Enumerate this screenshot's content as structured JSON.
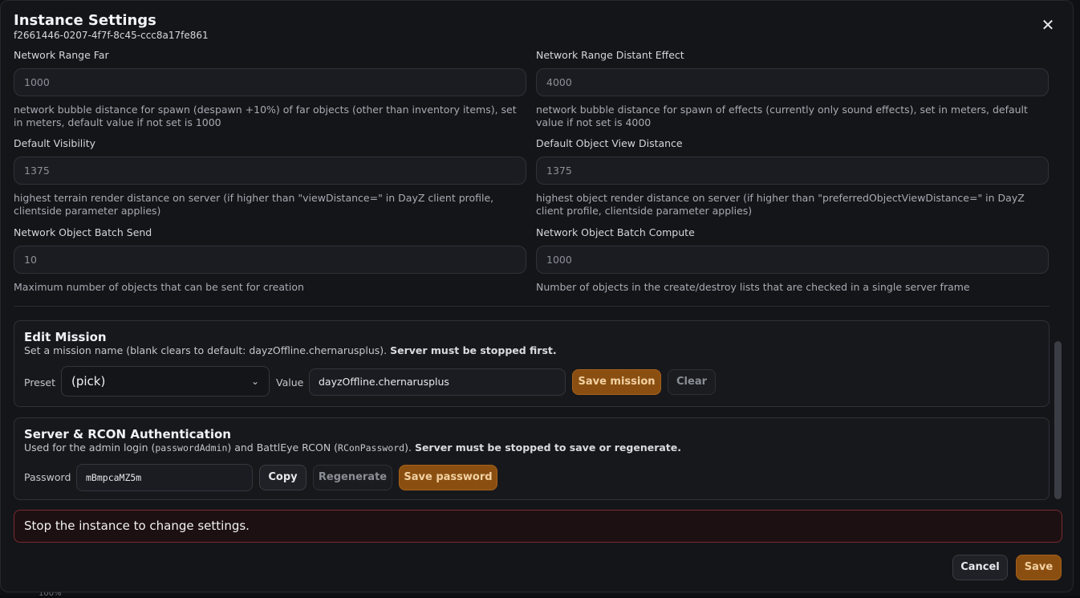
{
  "modal": {
    "title": "Instance Settings",
    "subtitle": "f2661446-0207-4f7f-8c45-ccc8a17fe861",
    "close_icon": "close-icon"
  },
  "fields": [
    {
      "label": "Network Range Far",
      "value": "1000",
      "help": "network bubble distance for spawn (despawn +10%) of far objects (other than inventory items), set in meters, default value if not set is 1000"
    },
    {
      "label": "Network Range Distant Effect",
      "value": "4000",
      "help": "network bubble distance for spawn of effects (currently only sound effects), set in meters, default value if not set is 4000"
    },
    {
      "label": "Default Visibility",
      "value": "1375",
      "help": "highest terrain render distance on server (if higher than \"viewDistance=\" in DayZ client profile, clientside parameter applies)"
    },
    {
      "label": "Default Object View Distance",
      "value": "1375",
      "help": "highest object render distance on server (if higher than \"preferredObjectViewDistance=\" in DayZ client profile, clientside parameter applies)"
    },
    {
      "label": "Network Object Batch Send",
      "value": "10",
      "help": "Maximum number of objects that can be sent for creation"
    },
    {
      "label": "Network Object Batch Compute",
      "value": "1000",
      "help": "Number of objects in the create/destroy lists that are checked in a single server frame"
    }
  ],
  "mission": {
    "title": "Edit Mission",
    "desc": "Set a mission name (blank clears to default: dayzOffline.chernarusplus).",
    "desc_bold": "Server must be stopped first.",
    "preset_label": "Preset",
    "preset_value": "(pick)",
    "value_label": "Value",
    "value": "dayzOffline.chernarusplus",
    "save_label": "Save mission",
    "clear_label": "Clear"
  },
  "auth": {
    "title": "Server & RCON Authentication",
    "desc_pre": "Used for the admin login (",
    "code1": "passwordAdmin",
    "desc_mid": ") and BattlEye RCON (",
    "code2": "RConPassword",
    "desc_post": ").",
    "desc_bold": "Server must be stopped to save or regenerate.",
    "password_label": "Password",
    "password_value": "mBmpcaMZ5m",
    "copy_label": "Copy",
    "regenerate_label": "Regenerate",
    "save_label": "Save password"
  },
  "alert": "Stop the instance to change settings.",
  "footer": {
    "cancel_label": "Cancel",
    "save_label": "Save"
  },
  "background": {
    "text": "100%"
  }
}
